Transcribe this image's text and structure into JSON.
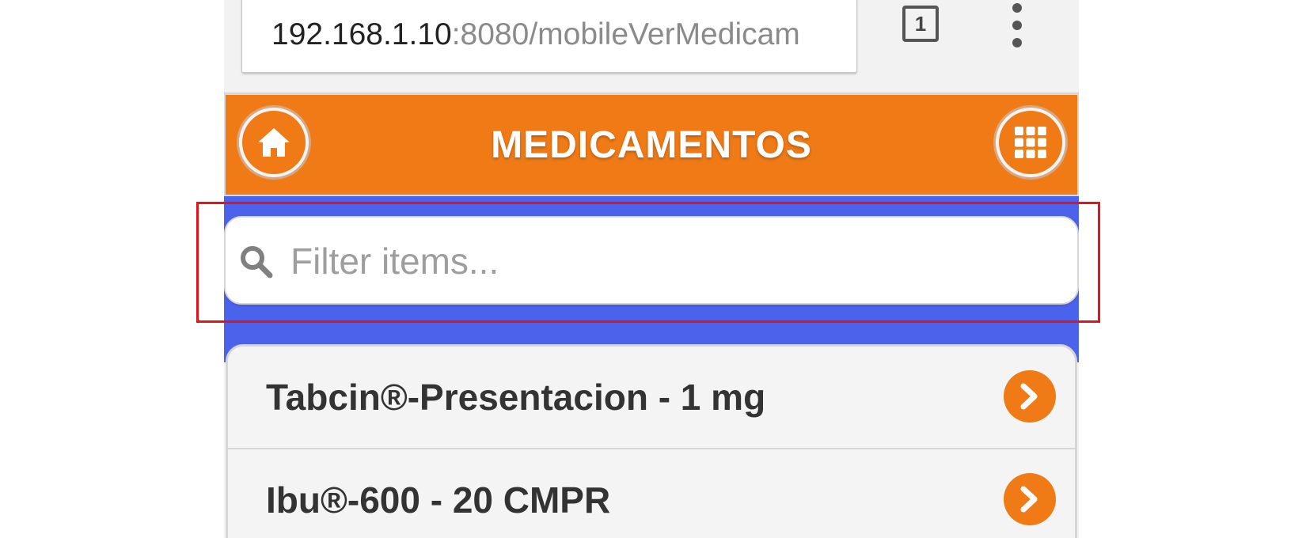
{
  "browser": {
    "url_host": "192.168.1.10",
    "url_path": ":8080/mobileVerMedicam",
    "tab_count": "1"
  },
  "header": {
    "title": "MEDICAMENTOS",
    "left_icon": "home-icon",
    "right_icon": "grid-icon"
  },
  "filter": {
    "placeholder": "Filter items...",
    "value": ""
  },
  "list": {
    "items": [
      {
        "label": "Tabcin®-Presentacion - 1 mg"
      },
      {
        "label": "Ibu®-600 - 20 CMPR"
      }
    ]
  },
  "colors": {
    "header_bg": "#ef7a16",
    "filter_band": "#4b63ea",
    "accent": "#ef7a16",
    "highlight": "#e3131b"
  }
}
